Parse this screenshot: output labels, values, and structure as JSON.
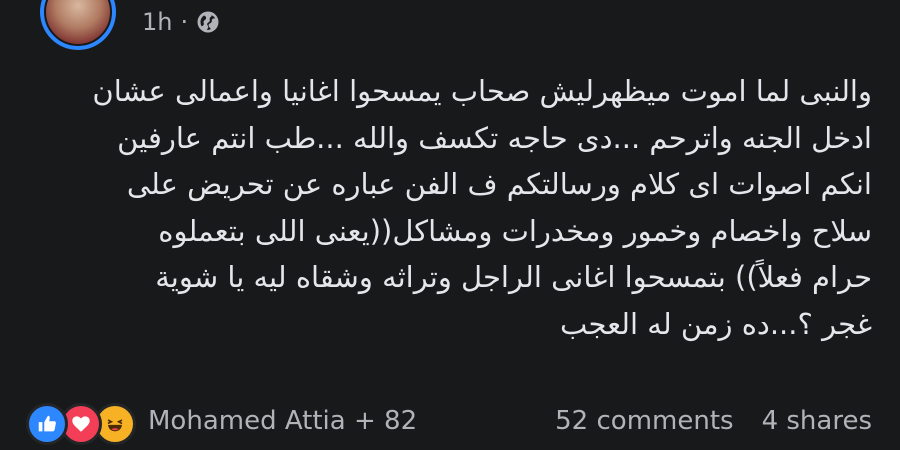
{
  "post": {
    "timestamp": "1h",
    "separator": "·",
    "privacy_icon": "globe-icon",
    "lines": [
      "والنبى لما اموت ميظهرليش صحاب يمسحوا اغانيا واعمالى عشان",
      "ادخل الجنه واترحم ...دى حاجه تكسف والله ...طب انتم عارفين",
      "انكم اصوات اى كلام ورسالتكم ف الفن عباره عن تحريض على",
      "سلاح واخصام وخمور ومخدرات ومشاكل((يعنى اللى بتعملوه",
      "حرام فعلاً)) بتمسحوا اغانى الراجل وتراثه وشقاه ليه يا شوية",
      "غجر ؟...ده زمن له العجب"
    ]
  },
  "reactions": {
    "icons": [
      "like-icon",
      "love-icon",
      "haha-icon"
    ],
    "summary": "Mohamed Attia + 82"
  },
  "stats": {
    "comments": "52 comments",
    "shares": "4 shares"
  },
  "colors": {
    "background": "#18191a",
    "text": "#e4e6eb",
    "secondary": "#b0b3b8",
    "avatar_ring": "#2d88ff",
    "like": "#2d88ff",
    "love": "#f33e58",
    "haha": "#f7b125"
  }
}
